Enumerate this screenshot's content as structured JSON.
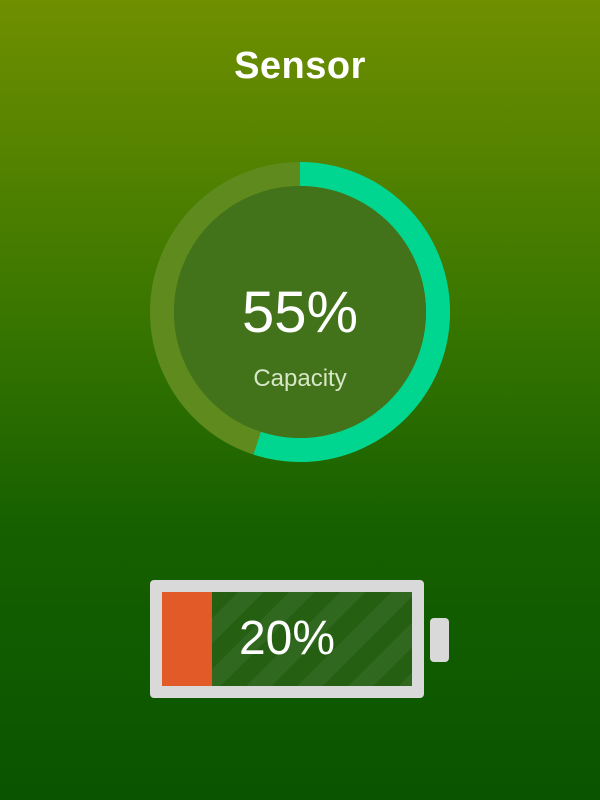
{
  "header": {
    "title": "Sensor"
  },
  "gauge": {
    "value_text": "55%",
    "label": "Capacity",
    "level_percent": 55,
    "colors": {
      "progress": "#00d68f",
      "track": "#5e8a1e",
      "center": "#42731a"
    }
  },
  "battery": {
    "value_text": "20%",
    "level_percent": 20,
    "colors": {
      "fill": "#e25a27",
      "body": "#245f12",
      "frame": "#d9d9d9"
    }
  }
}
